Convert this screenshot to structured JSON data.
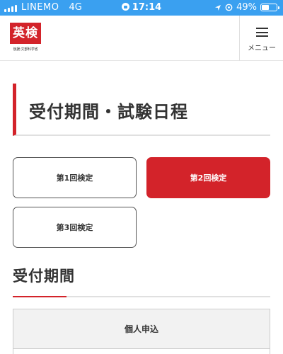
{
  "status_bar": {
    "carrier": "LINEMO",
    "network": "4G",
    "time": "17:14",
    "battery": "49%",
    "battery_level": 0.49
  },
  "header": {
    "logo_text": "英検",
    "logo_subtext": "後援:文部科学省",
    "menu_label": "メニュー",
    "brand_color": "#d3232a"
  },
  "page": {
    "title": "受付期間・試験日程"
  },
  "exam_tabs": [
    {
      "label": "第1回検定",
      "active": false
    },
    {
      "label": "第2回検定",
      "active": true
    },
    {
      "label": "第3回検定",
      "active": false
    }
  ],
  "section": {
    "heading": "受付期間",
    "table": {
      "header": "個人申込"
    }
  },
  "icons": [
    "signal-icon",
    "lock-rotation-icon",
    "location-arrow-icon",
    "alarm-icon",
    "battery-icon",
    "hamburger-menu-icon"
  ]
}
